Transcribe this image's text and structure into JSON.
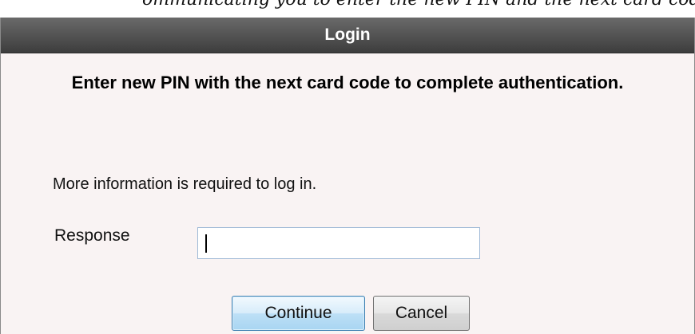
{
  "top_fragment_text": "ommunicating you to enter the new PIN and the next card code",
  "dialog": {
    "title": "Login",
    "headline": "Enter new PIN with the next card code to complete authentication.",
    "info": "More information is required to log in.",
    "response_label": "Response",
    "response_value": "",
    "continue_label": "Continue",
    "cancel_label": "Cancel"
  },
  "colors": {
    "title_bar": "#4a4a4a",
    "dialog_bg": "#f9f3f3",
    "continue_accent": "#3c7fb1"
  }
}
